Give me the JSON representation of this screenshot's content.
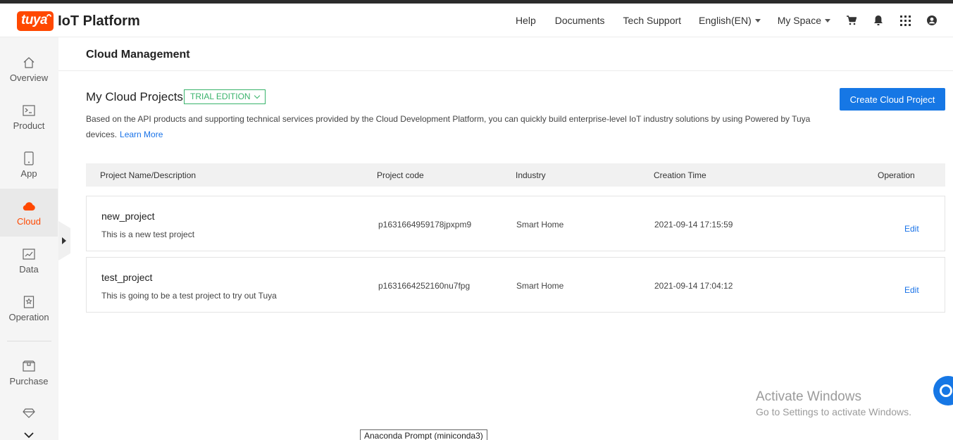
{
  "header": {
    "logo_badge": "tuya",
    "logo_text": "IoT Platform",
    "nav": {
      "help": "Help",
      "documents": "Documents",
      "tech_support": "Tech Support",
      "language": "English(EN)",
      "my_space": "My Space"
    },
    "icons": [
      "cart-icon",
      "bell-icon",
      "grid-icon",
      "user-icon"
    ]
  },
  "sidebar": {
    "items": [
      {
        "label": "Overview",
        "icon": "home-icon"
      },
      {
        "label": "Product",
        "icon": "terminal-icon"
      },
      {
        "label": "App",
        "icon": "phone-icon"
      },
      {
        "label": "Cloud",
        "icon": "cloud-icon",
        "active": true
      },
      {
        "label": "Data",
        "icon": "chart-icon"
      },
      {
        "label": "Operation",
        "icon": "bookmark-icon"
      },
      {
        "label": "Purchase",
        "icon": "box-icon"
      }
    ],
    "accent": "#ff4800"
  },
  "page": {
    "title": "Cloud Management",
    "section_title": "My Cloud Projects",
    "edition_badge": "TRIAL EDITION",
    "description": "Based on the API products and supporting technical services provided by the Cloud Development Platform, you can quickly build enterprise-level IoT industry solutions by using Powered by Tuya devices.",
    "learn_more": "Learn More",
    "create_button": "Create Cloud Project"
  },
  "table": {
    "columns": [
      "Project Name/Description",
      "Project code",
      "Industry",
      "Creation Time",
      "Operation"
    ],
    "rows": [
      {
        "name": "new_project",
        "description": "This is a new test project",
        "code": "p1631664959178jpxpm9",
        "industry": "Smart Home",
        "created": "2021-09-14 17:15:59",
        "operation": "Edit"
      },
      {
        "name": "test_project",
        "description": "This is going to be a test project to try out Tuya",
        "code": "p1631664252160nu7fpg",
        "industry": "Smart Home",
        "created": "2021-09-14 17:04:12",
        "operation": "Edit"
      }
    ]
  },
  "overlay": {
    "watermark_title": "Activate Windows",
    "watermark_sub": "Go to Settings to activate Windows.",
    "taskbar_tooltip": "Anaconda Prompt (miniconda3)"
  },
  "colors": {
    "primary": "#1677e5",
    "trial_green": "#39b36b",
    "brand_orange": "#ff4800"
  }
}
